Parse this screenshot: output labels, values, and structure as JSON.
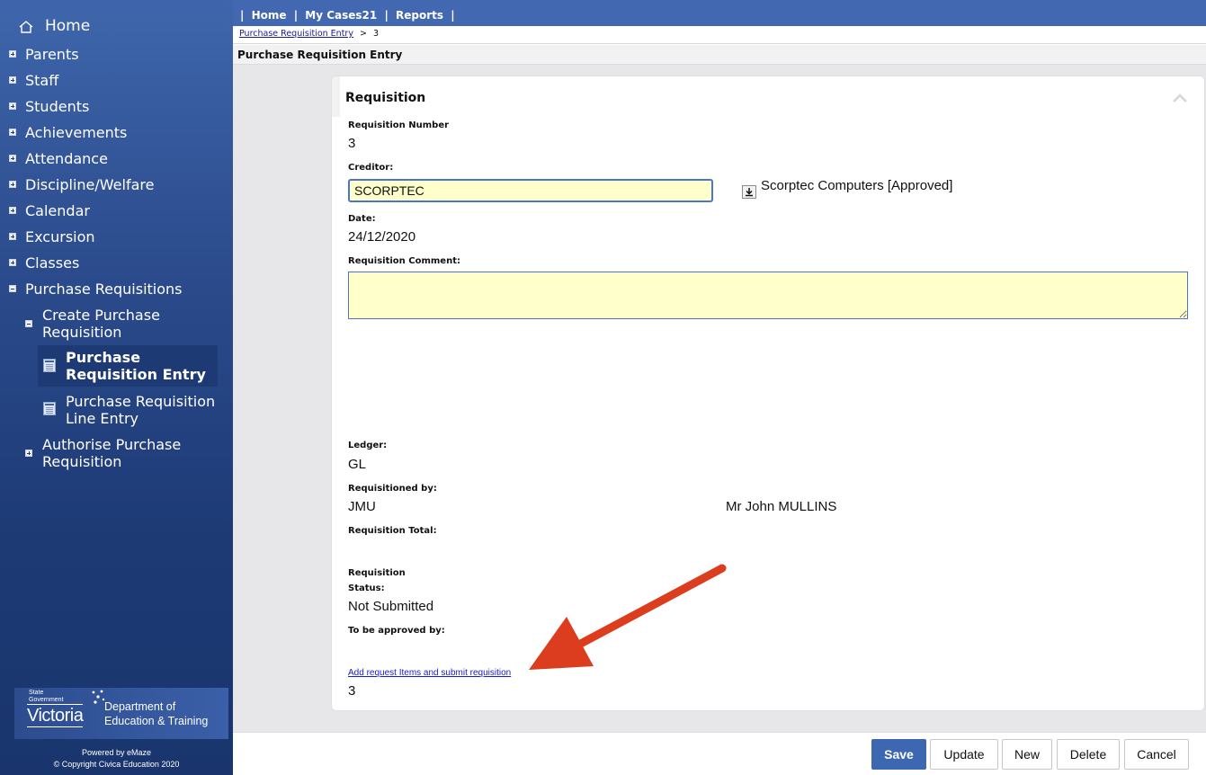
{
  "sidebar": {
    "home": "Home",
    "items": [
      "Parents",
      "Staff",
      "Students",
      "Achievements",
      "Attendance",
      "Discipline/Welfare",
      "Calendar",
      "Excursion",
      "Classes"
    ],
    "purchase_requisitions": "Purchase Requisitions",
    "create_purchase_requisition": "Create Purchase Requisition",
    "purchase_requisition_entry": "Purchase Requisition Entry",
    "purchase_requisition_line_entry": "Purchase Requisition Line Entry",
    "authorise_purchase_requisition": "Authorise Purchase Requisition",
    "logo": {
      "state": "State",
      "government": "Government",
      "victoria": "Victoria",
      "dept_line1": "Department of",
      "dept_line2": "Education & Training"
    },
    "powered_by": "Powered by eMaze",
    "copyright": "© Copyright Civica Education 2020"
  },
  "topnav": {
    "home": "Home",
    "my_cases": "My Cases21",
    "reports": "Reports",
    "separator": "|"
  },
  "breadcrumb": {
    "link": "Purchase Requisition Entry",
    "separator": ">",
    "current": "3"
  },
  "page_title": "Purchase Requisition Entry",
  "card": {
    "title": "Requisition",
    "requisition_number_label": "Requisition Number",
    "requisition_number": "3",
    "creditor_label": "Creditor:",
    "creditor_value": "SCORPTEC",
    "creditor_name": "Scorptec Computers [Approved]",
    "date_label": "Date:",
    "date_value": "24/12/2020",
    "comment_label": "Requisition Comment:",
    "comment_value": "",
    "ledger_label": "Ledger:",
    "ledger_value": "GL",
    "requisitioned_by_label": "Requisitioned by:",
    "requisitioned_by_code": "JMU",
    "requisitioned_by_name": "Mr John MULLINS",
    "total_label": "Requisition Total:",
    "status_label_1": "Requisition",
    "status_label_2": "Status:",
    "status_value": "Not Submitted",
    "approved_by_label": "To be approved by:",
    "submit_link": "Add request Items and submit requisition",
    "footer_value": "3"
  },
  "buttons": {
    "save": "Save",
    "update": "Update",
    "new": "New",
    "delete": "Delete",
    "cancel": "Cancel"
  },
  "colors": {
    "header_blue": "#4168b0",
    "sidebar_dark": "#1d3a75",
    "input_yellow": "#ffffcc",
    "annotation_arrow": "#dc3d1f"
  }
}
